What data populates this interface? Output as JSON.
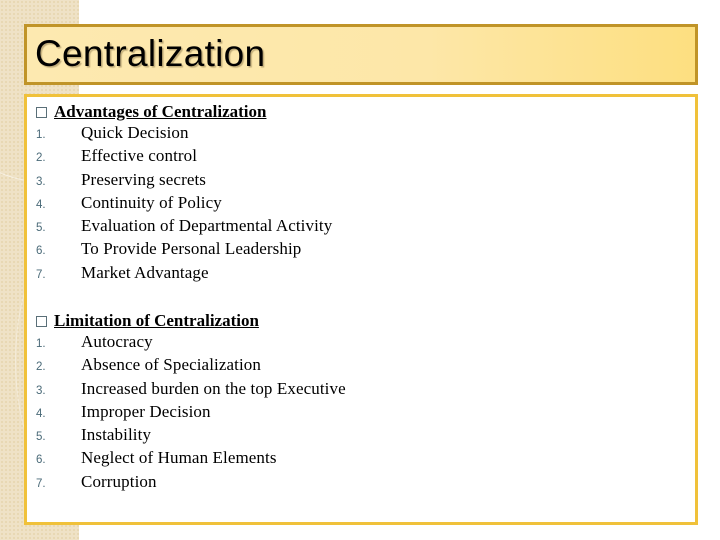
{
  "title": "Centralization",
  "sections": [
    {
      "heading": "Advantages of Centralization",
      "items": [
        {
          "num": "1.",
          "text": "Quick Decision"
        },
        {
          "num": "2.",
          "text": "Effective control"
        },
        {
          "num": "3.",
          "text": "Preserving secrets"
        },
        {
          "num": "4.",
          "text": "Continuity of Policy"
        },
        {
          "num": "5.",
          "text": "Evaluation of Departmental Activity"
        },
        {
          "num": "6.",
          "text": "To Provide Personal Leadership"
        },
        {
          "num": "7.",
          "text": "Market Advantage"
        }
      ]
    },
    {
      "heading": "Limitation of Centralization",
      "items": [
        {
          "num": "1.",
          "text": "Autocracy"
        },
        {
          "num": "2.",
          "text": "Absence of Specialization"
        },
        {
          "num": "3.",
          "text": "Increased burden on the top Executive"
        },
        {
          "num": "4.",
          "text": "Improper Decision"
        },
        {
          "num": "5.",
          "text": "Instability"
        },
        {
          "num": "6.",
          "text": "Neglect of Human Elements"
        },
        {
          "num": "7.",
          "text": "Corruption"
        }
      ]
    }
  ],
  "colors": {
    "title_border": "#c09428",
    "content_border": "#f0c13a",
    "title_fill": "#fde7a8",
    "texture": "#efe2c6"
  }
}
